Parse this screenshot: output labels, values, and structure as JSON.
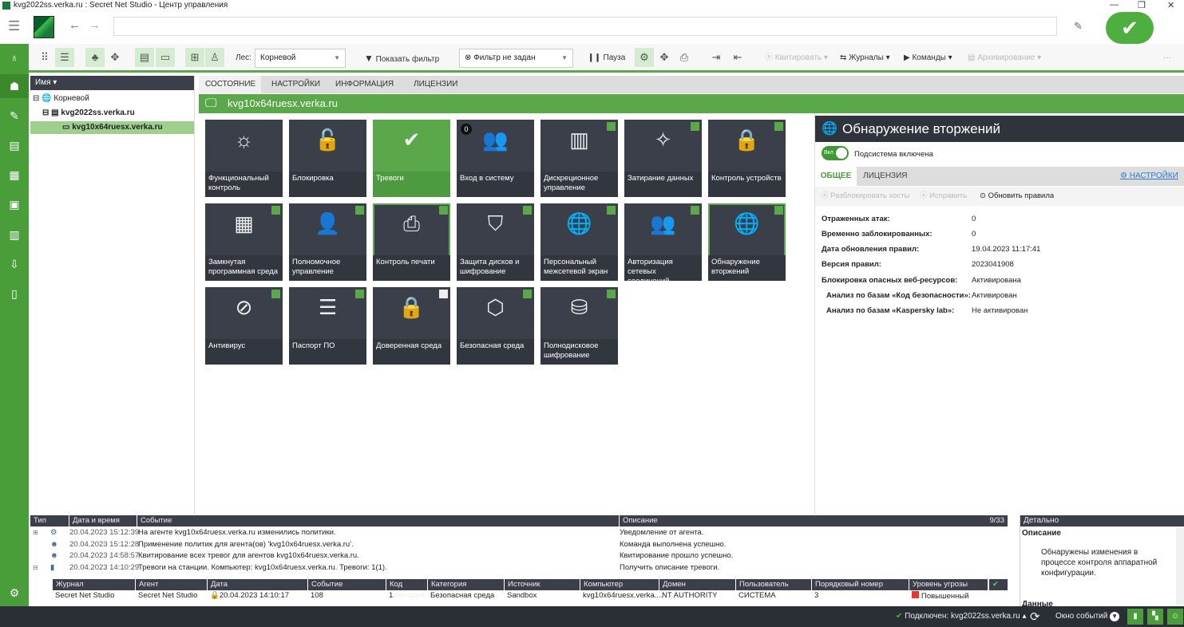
{
  "window": {
    "title": "kvg2022ss.verka.ru : Secret Net Studio - Центр управления"
  },
  "toolbar": {
    "forest_label": "Лес:",
    "forest_value": "Корневой",
    "show_filter": "Показать фильтр",
    "filter_value": "Фильтр не задан",
    "pause": "Пауза",
    "ack": "Квитировать",
    "journals": "Журналы",
    "commands": "Команды",
    "archiving": "Архивирование",
    "more": "···"
  },
  "tree": {
    "header": "Имя",
    "nodes": [
      "Корневой",
      "kvg2022ss.verka.ru",
      "kvg10x64ruesx.verka.ru"
    ]
  },
  "tabs": [
    "СОСТОЯНИЕ",
    "НАСТРОЙКИ",
    "ИНФОРМАЦИЯ",
    "ЛИЦЕНЗИИ"
  ],
  "host": "kvg10x64ruesx.verka.ru",
  "tiles": [
    {
      "label": "Функциональный контроль",
      "icon": "☼",
      "state": "none"
    },
    {
      "label": "Блокировка",
      "icon": "🔓",
      "state": "none"
    },
    {
      "label": "Тревоги",
      "icon": "✔",
      "state": "green"
    },
    {
      "label": "Вход в систему",
      "icon": "👥",
      "state": "badge",
      "badge": "0"
    },
    {
      "label": "Дискреционное управление",
      "icon": "▥",
      "state": "on"
    },
    {
      "label": "Затирание данных",
      "icon": "✧",
      "state": "on"
    },
    {
      "label": "Контроль устройств",
      "icon": "🔒",
      "state": "on"
    },
    {
      "label": "Замкнутая программная среда",
      "icon": "▦",
      "state": "on"
    },
    {
      "label": "Полномочное управление",
      "icon": "👤",
      "state": "on"
    },
    {
      "label": "Контроль печати",
      "icon": "⎙",
      "state": "on",
      "selected": true
    },
    {
      "label": "Защита дисков и шифрование",
      "icon": "⛉",
      "state": "on"
    },
    {
      "label": "Персональный межсетевой экран",
      "icon": "🌐",
      "state": "on"
    },
    {
      "label": "Авторизация сетевых соединений",
      "icon": "👥",
      "state": "on"
    },
    {
      "label": "Обнаружение вторжений",
      "icon": "🌐",
      "state": "on",
      "selected": true
    },
    {
      "label": "Антивирус",
      "icon": "⊘",
      "state": "on"
    },
    {
      "label": "Паспорт ПО",
      "icon": "☰",
      "state": "on"
    },
    {
      "label": "Доверенная среда",
      "icon": "🔒",
      "state": "off"
    },
    {
      "label": "Безопасная среда",
      "icon": "⬡",
      "state": "on"
    },
    {
      "label": "Полнодисковое шифрование",
      "icon": "⛁",
      "state": "on"
    }
  ],
  "panel": {
    "title": "Обнаружение вторжений",
    "toggle": "Вкл",
    "toggle_label": "Подсистема включена",
    "tab_general": "ОБЩЕЕ",
    "tab_license": "ЛИЦЕНЗИЯ",
    "settings": "НАСТРОЙКИ",
    "unblock": "Разблокировать хосты",
    "fix": "Исправить",
    "update": "Обновить правила",
    "rows": [
      [
        "Отраженных атак:",
        "0"
      ],
      [
        "Временно заблокированных:",
        "0"
      ],
      [
        "Дата обновления правил:",
        "19.04.2023 11:17:41"
      ],
      [
        "Версия правил:",
        "2023041908"
      ],
      [
        "Блокировка опасных веб-ресурсов:",
        "Активирована"
      ],
      [
        "Анализ по базам «Код безопасности»:",
        "Активирован"
      ],
      [
        "Анализ по базам «Kaspersky lab»:",
        "Не активирован"
      ]
    ]
  },
  "log": {
    "headers": [
      "Тип",
      "Дата и время",
      "Событие",
      "Описание"
    ],
    "count": "9/33",
    "rows": [
      [
        "20.04.2023 15:12:39",
        "На агенте kvg10x64ruesx.verka.ru изменились политики.",
        "Уведомление от агента."
      ],
      [
        "20.04.2023 15:12:28",
        "Применение политик для агента(ов) 'kvg10x64ruesx.verka.ru'.",
        "Команда выполнена успешно."
      ],
      [
        "20.04.2023 14:58:57",
        "Квитирование всех тревог для агентов kvg10x64ruesx.verka.ru.",
        "Квитирование прошло успешно."
      ],
      [
        "20.04.2023 14:10:29",
        "Тревоги на станции. Компьютер: kvg10x64ruesx.verka.ru. Тревоги: 1(1).",
        "Получить описание тревоги."
      ]
    ],
    "sub_headers": [
      "Журнал",
      "Агент",
      "Дата",
      "Событие",
      "Код категории",
      "Категория",
      "Источник",
      "Компьютер",
      "Домен",
      "Пользователь",
      "Порядковый номер",
      "Уровень угрозы"
    ],
    "sub_row": [
      "Secret Net Studio",
      "Secret Net Studio",
      "20.04.2023 14:10:17",
      "108",
      "1",
      "Безопасная среда",
      "Sandbox",
      "kvg10x64ruesx.verka....",
      "NT AUTHORITY",
      "СИСТЕМА",
      "3",
      "Повышенный"
    ]
  },
  "detail": {
    "header": "Детально",
    "title": "Описание",
    "text": "Обнаружены изменения в процессе контроля аппаратной конфигурации.",
    "more": "Данные"
  },
  "status": {
    "connected": "Подключен: kvg2022ss.verka.ru",
    "events_window": "Окно событий"
  },
  "colors": {
    "accent": "#5aa84a",
    "dark": "#3a3f4a",
    "threat": "#e53a2a"
  }
}
